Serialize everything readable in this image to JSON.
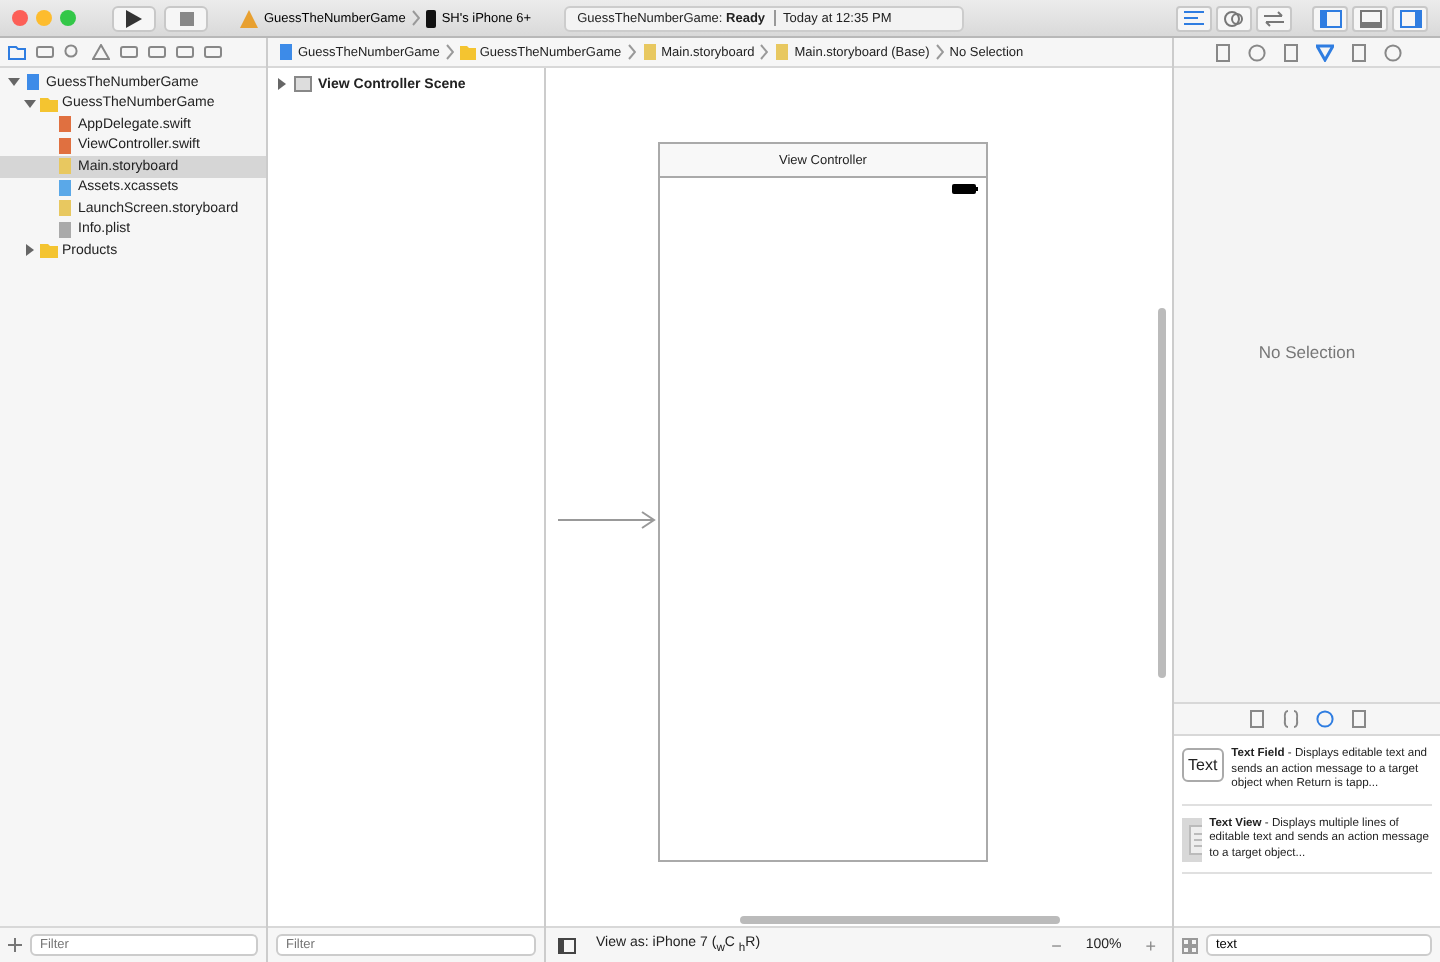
{
  "toolbar": {
    "scheme": "GuessTheNumberGame",
    "device": "SH's iPhone 6+",
    "status_project": "GuessTheNumberGame:",
    "status_state": "Ready",
    "status_time": "Today at 12:35 PM",
    "editor_modes": [
      {
        "kind": "standard",
        "selected": true
      },
      {
        "kind": "assistant",
        "selected": false
      },
      {
        "kind": "version",
        "selected": false
      }
    ],
    "panels": [
      {
        "kind": "left",
        "selected": true
      },
      {
        "kind": "bottom",
        "selected": false
      },
      {
        "kind": "right",
        "selected": true
      }
    ]
  },
  "navigator": {
    "tabs": [
      {
        "kind": "folder",
        "selected": true
      },
      {
        "kind": "hierarchy",
        "selected": false
      },
      {
        "kind": "search",
        "selected": false
      },
      {
        "kind": "warning",
        "selected": false
      },
      {
        "kind": "test",
        "selected": false
      },
      {
        "kind": "debug",
        "selected": false
      },
      {
        "kind": "breakpoint",
        "selected": false
      },
      {
        "kind": "report",
        "selected": false
      }
    ],
    "tree": [
      {
        "label": "GuessTheNumberGame",
        "kind": "project",
        "expanded": true,
        "selected": false,
        "children": [
          {
            "label": "GuessTheNumberGame",
            "kind": "folder",
            "expanded": true,
            "selected": false,
            "children": [
              {
                "label": "AppDelegate.swift",
                "kind": "swift",
                "selected": false
              },
              {
                "label": "ViewController.swift",
                "kind": "swift",
                "selected": false
              },
              {
                "label": "Main.storyboard",
                "kind": "storyboard",
                "selected": true
              },
              {
                "label": "Assets.xcassets",
                "kind": "assets",
                "selected": false
              },
              {
                "label": "LaunchScreen.storyboard",
                "kind": "storyboard",
                "selected": false
              },
              {
                "label": "Info.plist",
                "kind": "plist",
                "selected": false
              }
            ]
          },
          {
            "label": "Products",
            "kind": "folder",
            "expanded": false,
            "selected": false
          }
        ]
      }
    ],
    "filter_placeholder": "Filter"
  },
  "jump_bar": [
    {
      "label": "GuessTheNumberGame",
      "kind": "project"
    },
    {
      "label": "GuessTheNumberGame",
      "kind": "folder"
    },
    {
      "label": "Main.storyboard",
      "kind": "storyboard"
    },
    {
      "label": "Main.storyboard (Base)",
      "kind": "storyboard"
    },
    {
      "label": "No Selection",
      "kind": "none"
    }
  ],
  "outline": {
    "items": [
      {
        "label": "View Controller Scene",
        "expanded": false
      }
    ],
    "filter_placeholder": "Filter"
  },
  "canvas": {
    "scene_title": "View Controller",
    "view_as": "View as: iPhone 7 ($_{w}$C $_{h}$R)",
    "zoom_out": "−",
    "zoom": "100%",
    "zoom_in": "+"
  },
  "inspector": {
    "tabs": [
      {
        "kind": "file",
        "selected": false
      },
      {
        "kind": "help",
        "selected": false
      },
      {
        "kind": "identity",
        "selected": false
      },
      {
        "kind": "attributes",
        "selected": true
      },
      {
        "kind": "size",
        "selected": false
      },
      {
        "kind": "connections",
        "selected": false
      }
    ],
    "empty_message": "No Selection"
  },
  "library": {
    "tabs": [
      {
        "kind": "file",
        "selected": false
      },
      {
        "kind": "snippet",
        "selected": false
      },
      {
        "kind": "object",
        "selected": true
      },
      {
        "kind": "media",
        "selected": false
      }
    ],
    "items": [
      {
        "kind": "text-field",
        "icon_text": "Text",
        "text": "**Text Field** - Displays editable text and sends an action message to a target object when Return is tapp..."
      },
      {
        "kind": "text-view",
        "text": "**Text View** - Displays multiple lines of editable text and sends an action message to a target object..."
      }
    ],
    "search_value": "text"
  }
}
